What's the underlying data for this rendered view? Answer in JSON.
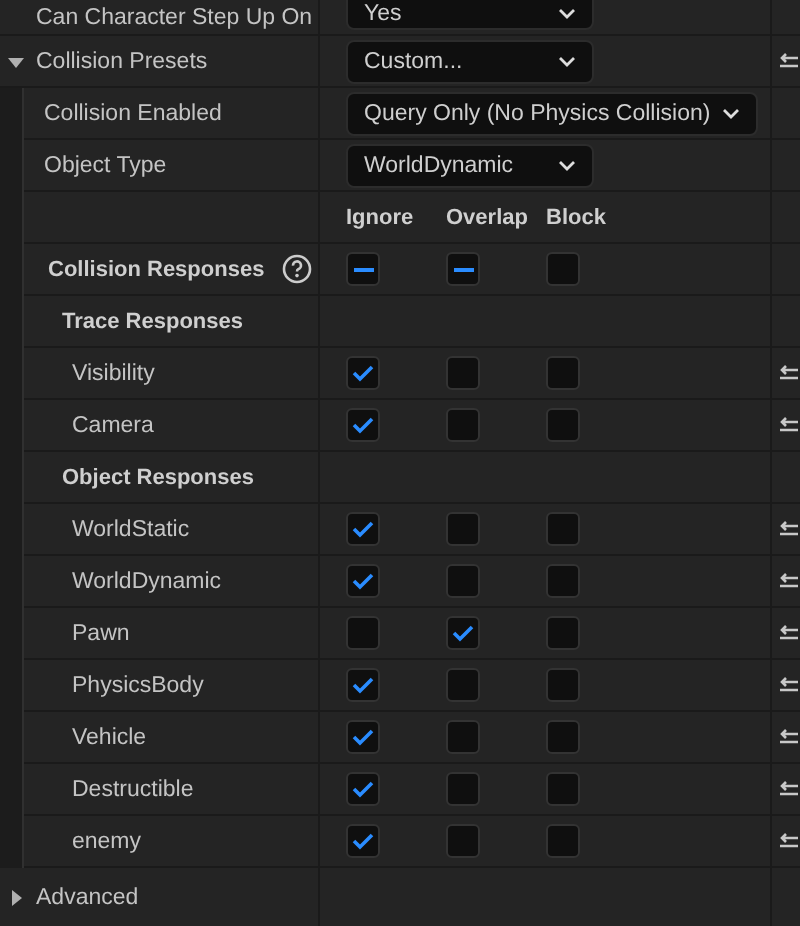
{
  "step_up": {
    "label": "Can Character Step Up On",
    "value": "Yes"
  },
  "collision_presets": {
    "label": "Collision Presets",
    "value": "Custom...",
    "expanded": true,
    "children": [
      {
        "label": "Collision Enabled",
        "value": "Query Only (No Physics Collision)"
      },
      {
        "label": "Object Type",
        "value": "WorldDynamic"
      }
    ],
    "response_columns": [
      "Ignore",
      "Overlap",
      "Block"
    ],
    "collision_responses": {
      "label": "Collision Responses",
      "states": [
        {
          "mixed": true
        },
        {
          "mixed": true
        },
        {
          "mixed": false
        }
      ]
    },
    "groups": [
      {
        "title": "Trace Responses",
        "channels": [
          {
            "name": "Visibility",
            "responses": [
              {
                "checked": true
              },
              {
                "checked": false
              },
              {
                "checked": false
              }
            ]
          },
          {
            "name": "Camera",
            "responses": [
              {
                "checked": true
              },
              {
                "checked": false
              },
              {
                "checked": false
              }
            ]
          }
        ]
      },
      {
        "title": "Object Responses",
        "channels": [
          {
            "name": "WorldStatic",
            "responses": [
              {
                "checked": true
              },
              {
                "checked": false
              },
              {
                "checked": false
              }
            ]
          },
          {
            "name": "WorldDynamic",
            "responses": [
              {
                "checked": true
              },
              {
                "checked": false
              },
              {
                "checked": false
              }
            ]
          },
          {
            "name": "Pawn",
            "responses": [
              {
                "checked": false
              },
              {
                "checked": true
              },
              {
                "checked": false
              }
            ]
          },
          {
            "name": "PhysicsBody",
            "responses": [
              {
                "checked": true
              },
              {
                "checked": false
              },
              {
                "checked": false
              }
            ]
          },
          {
            "name": "Vehicle",
            "responses": [
              {
                "checked": true
              },
              {
                "checked": false
              },
              {
                "checked": false
              }
            ]
          },
          {
            "name": "Destructible",
            "responses": [
              {
                "checked": true
              },
              {
                "checked": false
              },
              {
                "checked": false
              }
            ]
          },
          {
            "name": "enemy",
            "responses": [
              {
                "checked": true
              },
              {
                "checked": false
              },
              {
                "checked": false
              }
            ]
          }
        ]
      }
    ]
  },
  "advanced": {
    "label": "Advanced",
    "expanded": false
  }
}
